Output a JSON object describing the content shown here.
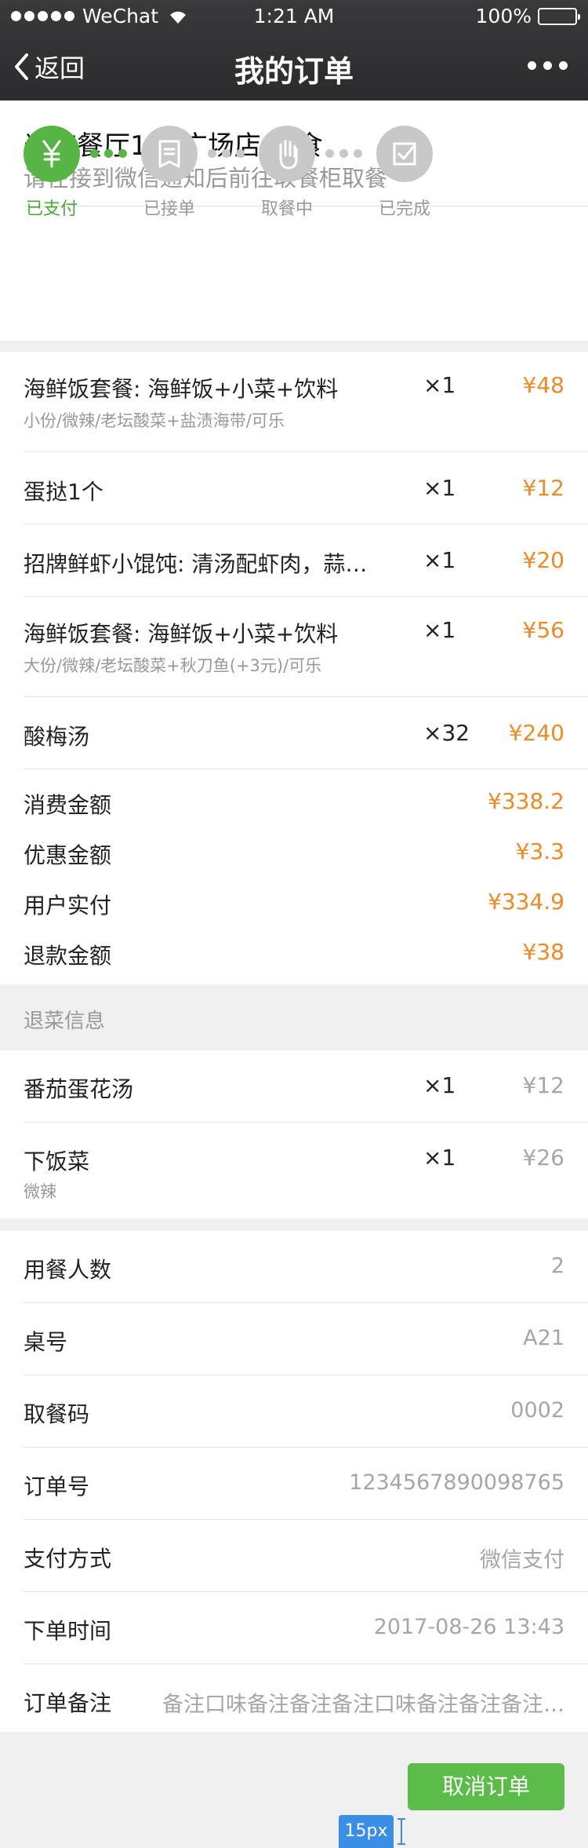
{
  "status_bar": {
    "carrier": "WeChat",
    "time": "1:21 AM",
    "battery": "100%"
  },
  "nav": {
    "back_label": "返回",
    "title": "我的订单"
  },
  "header": {
    "store": "米趣餐厅118广场店 堂食",
    "notice": "请在接到微信通知后前往取餐柜取餐"
  },
  "steps": [
    {
      "label": "已支付",
      "icon": "yuan-icon",
      "active": true
    },
    {
      "label": "已接单",
      "icon": "receipt-icon",
      "active": false
    },
    {
      "label": "取餐中",
      "icon": "hand-icon",
      "active": false
    },
    {
      "label": "已完成",
      "icon": "check-icon",
      "active": false
    }
  ],
  "items": [
    {
      "name": "海鲜饭套餐: 海鲜饭+小菜+饮料",
      "sub": "小份/微辣/老坛酸菜+盐渍海带/可乐",
      "qty": "×1",
      "price": "¥48"
    },
    {
      "name": "蛋挞1个",
      "sub": "",
      "qty": "×1",
      "price": "¥12"
    },
    {
      "name": "招牌鲜虾小馄饨: 清汤配虾肉，蒜…",
      "sub": "",
      "qty": "×1",
      "price": "¥20"
    },
    {
      "name": "海鲜饭套餐: 海鲜饭+小菜+饮料",
      "sub": "大份/微辣/老坛酸菜+秋刀鱼(+3元)/可乐",
      "qty": "×1",
      "price": "¥56"
    },
    {
      "name": "酸梅汤",
      "sub": "",
      "qty": "×32",
      "price": "¥240"
    }
  ],
  "summary": [
    {
      "label": "消费金额",
      "value": "¥338.2"
    },
    {
      "label": "优惠金额",
      "value": "¥3.3"
    },
    {
      "label": "用户实付",
      "value": "¥334.9"
    },
    {
      "label": "退款金额",
      "value": "¥38"
    }
  ],
  "refund_section": {
    "title": "退菜信息",
    "items": [
      {
        "name": "番茄蛋花汤",
        "sub": "",
        "qty": "×1",
        "price": "¥12"
      },
      {
        "name": "下饭菜",
        "sub": "微辣",
        "qty": "×1",
        "price": "¥26"
      }
    ]
  },
  "info": [
    {
      "label": "用餐人数",
      "value": "2"
    },
    {
      "label": "桌号",
      "value": "A21"
    },
    {
      "label": "取餐码",
      "value": "0002"
    },
    {
      "label": "订单号",
      "value": "1234567890098765"
    },
    {
      "label": "支付方式",
      "value": "微信支付"
    },
    {
      "label": "下单时间",
      "value": "2017-08-26 13:43"
    },
    {
      "label": "订单备注",
      "value": "备注口味备注备注备注口味备注备注备注…"
    }
  ],
  "cancel_label": "取消订单",
  "measure_label": "15px",
  "colors": {
    "accent_green": "#56b544",
    "price_orange": "#f08a24",
    "muted_grey": "#a6a6a6"
  }
}
